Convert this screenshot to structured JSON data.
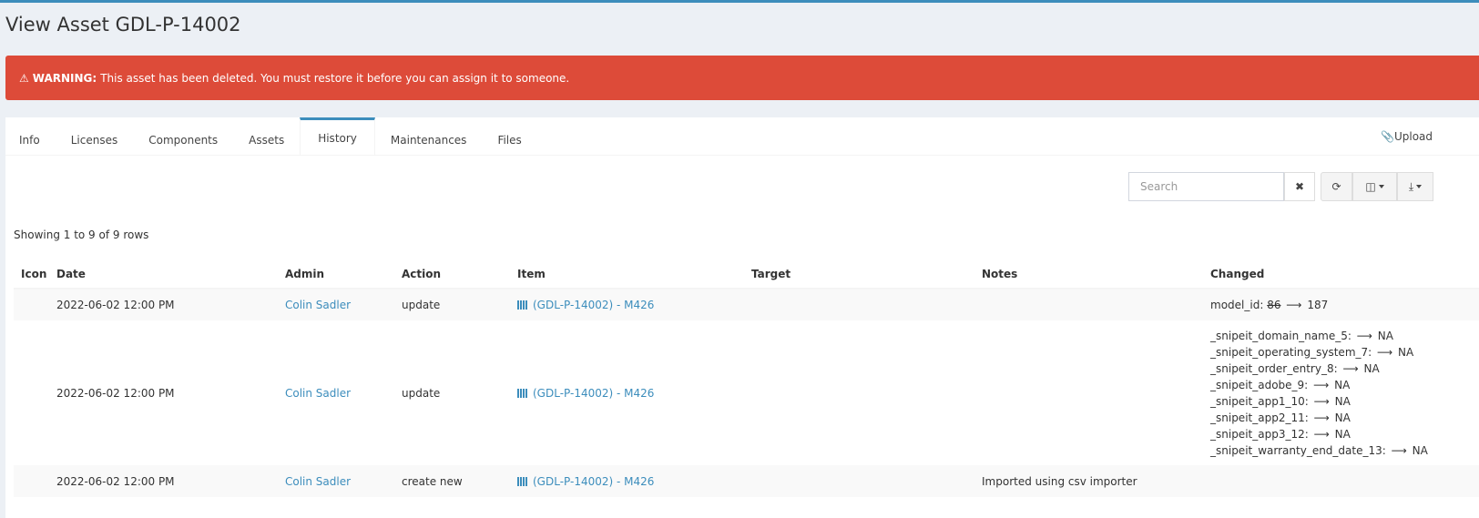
{
  "page": {
    "title": "View Asset GDL-P-14002"
  },
  "alert": {
    "label": "WARNING:",
    "message": "This asset has been deleted. You must restore it before you can assign it to someone."
  },
  "tabs": [
    {
      "label": "Info"
    },
    {
      "label": "Licenses"
    },
    {
      "label": "Components"
    },
    {
      "label": "Assets"
    },
    {
      "label": "History",
      "active": true
    },
    {
      "label": "Maintenances"
    },
    {
      "label": "Files"
    }
  ],
  "upload_label": "Upload",
  "toolbar": {
    "search_placeholder": "Search"
  },
  "pagination": {
    "showing": "Showing 1 to 9 of 9 rows"
  },
  "table": {
    "headers": {
      "icon": "Icon",
      "date": "Date",
      "admin": "Admin",
      "action": "Action",
      "item": "Item",
      "target": "Target",
      "notes": "Notes",
      "changed": "Changed"
    },
    "rows": [
      {
        "date": "2022-06-02 12:00 PM",
        "admin": "Colin Sadler",
        "action": "update",
        "item": "(GDL-P-14002) - M426",
        "target": "",
        "notes": "",
        "changed": [
          {
            "field": "model_id:",
            "old": "86",
            "new": "187"
          }
        ]
      },
      {
        "date": "2022-06-02 12:00 PM",
        "admin": "Colin Sadler",
        "action": "update",
        "item": "(GDL-P-14002) - M426",
        "target": "",
        "notes": "",
        "changed": [
          {
            "field": "_snipeit_domain_name_5:",
            "old": "",
            "new": "NA"
          },
          {
            "field": "_snipeit_operating_system_7:",
            "old": "",
            "new": "NA"
          },
          {
            "field": "_snipeit_order_entry_8:",
            "old": "",
            "new": "NA"
          },
          {
            "field": "_snipeit_adobe_9:",
            "old": "",
            "new": "NA"
          },
          {
            "field": "_snipeit_app1_10:",
            "old": "",
            "new": "NA"
          },
          {
            "field": "_snipeit_app2_11:",
            "old": "",
            "new": "NA"
          },
          {
            "field": "_snipeit_app3_12:",
            "old": "",
            "new": "NA"
          },
          {
            "field": "_snipeit_warranty_end_date_13:",
            "old": "",
            "new": "NA"
          }
        ]
      },
      {
        "date": "2022-06-02 12:00 PM",
        "admin": "Colin Sadler",
        "action": "create new",
        "item": "(GDL-P-14002) - M426",
        "target": "",
        "notes": "Imported using csv importer",
        "changed": []
      }
    ]
  }
}
